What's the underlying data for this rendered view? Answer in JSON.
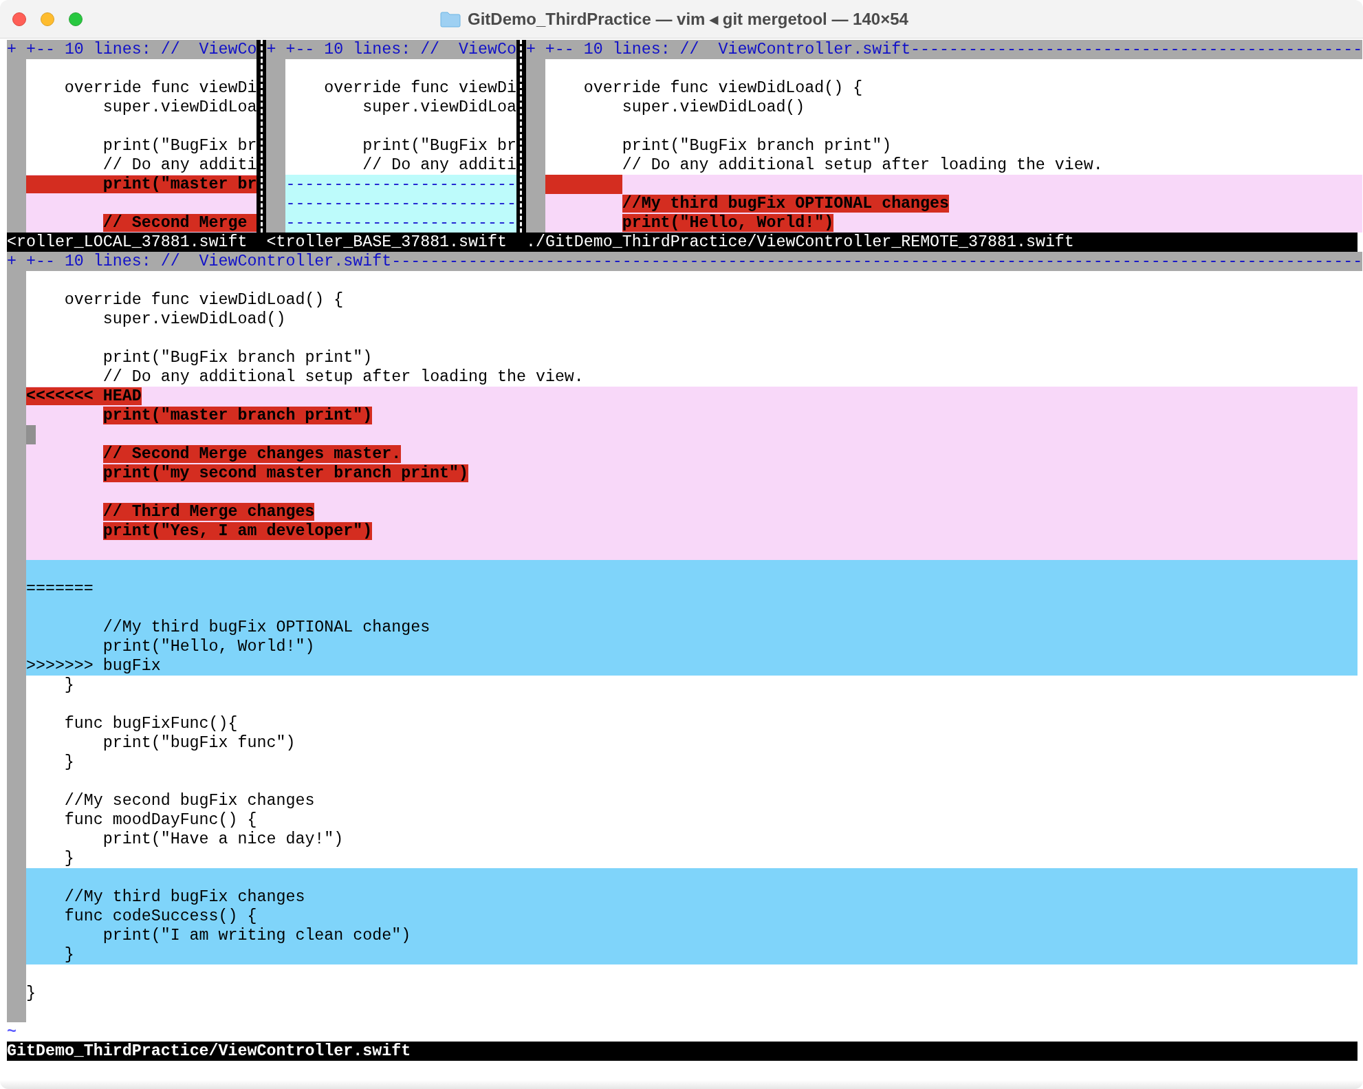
{
  "window": {
    "title": "GitDemo_ThirdPractice — vim ◂ git mergetool — 140×54"
  },
  "top_panes": [
    {
      "fold": "+ +-- 10 lines: //  ViewCo",
      "status": "<roller_LOCAL_37881.swift",
      "lines": [
        {
          "kind": "plain"
        },
        {
          "kind": "plain",
          "text": "    override func viewDi"
        },
        {
          "kind": "plain",
          "text": "        super.viewDidLoa"
        },
        {
          "kind": "plain"
        },
        {
          "kind": "plain",
          "text": "        print(\"BugFix br"
        },
        {
          "kind": "plain",
          "text": "        // Do any additi"
        },
        {
          "kind": "change",
          "text": "        print(\"master br",
          "hl": true
        },
        {
          "kind": "change"
        },
        {
          "kind": "change",
          "indented": true,
          "text": "// Second Merge ",
          "hl": true
        }
      ]
    },
    {
      "fold": "+ +-- 10 lines: //  ViewCo",
      "status": "<troller_BASE_37881.swift",
      "lines": [
        {
          "kind": "plain"
        },
        {
          "kind": "plain",
          "text": "    override func viewDi"
        },
        {
          "kind": "plain",
          "text": "        super.viewDidLoa"
        },
        {
          "kind": "plain"
        },
        {
          "kind": "plain",
          "text": "        print(\"BugFix br"
        },
        {
          "kind": "plain",
          "text": "        // Do any additi"
        },
        {
          "kind": "filler",
          "text": "------------------------"
        },
        {
          "kind": "filler",
          "text": "------------------------"
        },
        {
          "kind": "filler",
          "text": "------------------------"
        }
      ]
    },
    {
      "fold": "+ +-- 10 lines: //  ViewController.swift-----------------------------------------------",
      "status": "./GitDemo_ThirdPractice/ViewController_REMOTE_37881.swift",
      "lines": [
        {
          "kind": "plain"
        },
        {
          "kind": "plain",
          "text": "    override func viewDidLoad() {"
        },
        {
          "kind": "plain",
          "text": "        super.viewDidLoad()"
        },
        {
          "kind": "plain"
        },
        {
          "kind": "plain",
          "text": "        print(\"BugFix branch print\")"
        },
        {
          "kind": "plain",
          "text": "        // Do any additional setup after loading the view."
        },
        {
          "kind": "change",
          "tab_hl": true
        },
        {
          "kind": "change",
          "indented": true,
          "text": "//My third bugFix OPTIONAL changes",
          "hl": true
        },
        {
          "kind": "change",
          "indented": true,
          "text": "print(\"Hello, World!\")",
          "hl": true
        }
      ]
    }
  ],
  "bottom_pane": {
    "fold": "+ +-- 10 lines: //  ViewController.swift-----------------------------------------------------------------------------------------------------",
    "lines": [
      {
        "kind": "plain"
      },
      {
        "kind": "plain",
        "text": "    override func viewDidLoad() {"
      },
      {
        "kind": "plain",
        "text": "        super.viewDidLoad()"
      },
      {
        "kind": "plain"
      },
      {
        "kind": "plain",
        "text": "        print(\"BugFix branch print\")"
      },
      {
        "kind": "plain",
        "text": "        // Do any additional setup after loading the view."
      },
      {
        "kind": "change",
        "text": "<<<<<<< HEAD",
        "hl": true
      },
      {
        "kind": "change",
        "indented": true,
        "text": "print(\"master branch print\")",
        "hl": true
      },
      {
        "kind": "change",
        "cursor": true
      },
      {
        "kind": "change",
        "indented": true,
        "text": "// Second Merge changes master.",
        "hl": true
      },
      {
        "kind": "change",
        "indented": true,
        "text": "print(\"my second master branch print\")",
        "hl": true
      },
      {
        "kind": "change"
      },
      {
        "kind": "change",
        "indented": true,
        "text": "// Third Merge changes",
        "hl": true
      },
      {
        "kind": "change",
        "indented": true,
        "text": "print(\"Yes, I am developer\")",
        "hl": true
      },
      {
        "kind": "change"
      },
      {
        "kind": "add"
      },
      {
        "kind": "add",
        "text": "======="
      },
      {
        "kind": "add"
      },
      {
        "kind": "add",
        "text": "        //My third bugFix OPTIONAL changes"
      },
      {
        "kind": "add",
        "text": "        print(\"Hello, World!\")"
      },
      {
        "kind": "add",
        "text": ">>>>>>> bugFix"
      },
      {
        "kind": "plain",
        "text": "    }"
      },
      {
        "kind": "plain"
      },
      {
        "kind": "plain",
        "text": "    func bugFixFunc(){"
      },
      {
        "kind": "plain",
        "text": "        print(\"bugFix func\")"
      },
      {
        "kind": "plain",
        "text": "    }"
      },
      {
        "kind": "plain"
      },
      {
        "kind": "plain",
        "text": "    //My second bugFix changes"
      },
      {
        "kind": "plain",
        "text": "    func moodDayFunc() {"
      },
      {
        "kind": "plain",
        "text": "        print(\"Have a nice day!\")"
      },
      {
        "kind": "plain",
        "text": "    }"
      },
      {
        "kind": "add"
      },
      {
        "kind": "add",
        "text": "    //My third bugFix changes"
      },
      {
        "kind": "add",
        "text": "    func codeSuccess() {"
      },
      {
        "kind": "add",
        "text": "        print(\"I am writing clean code\")"
      },
      {
        "kind": "add",
        "text": "    }"
      },
      {
        "kind": "plain"
      },
      {
        "kind": "plain",
        "text": "}"
      },
      {
        "kind": "plain"
      }
    ],
    "tilde": "~",
    "status": "GitDemo_ThirdPractice/ViewController.swift"
  }
}
